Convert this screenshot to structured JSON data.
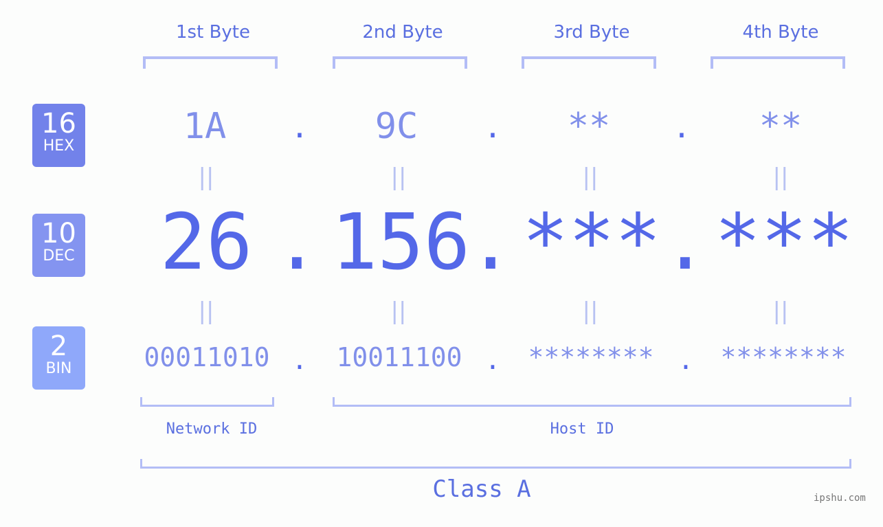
{
  "byte_headers": [
    "1st Byte",
    "2nd Byte",
    "3rd Byte",
    "4th Byte"
  ],
  "badges": [
    {
      "num": "16",
      "label": "HEX",
      "color": "#7282ea"
    },
    {
      "num": "10",
      "label": "DEC",
      "color": "#8494f0"
    },
    {
      "num": "2",
      "label": "BIN",
      "color": "#8fa8fa"
    }
  ],
  "hex": [
    "1A",
    "9C",
    "**",
    "**"
  ],
  "dec": [
    "26",
    "156",
    "***",
    "***"
  ],
  "bin": [
    "00011010",
    "10011100",
    "********",
    "********"
  ],
  "separator": ".",
  "equals": "||",
  "network_id_label": "Network ID",
  "host_id_label": "Host ID",
  "class_label": "Class A",
  "watermark": "ipshu.com"
}
